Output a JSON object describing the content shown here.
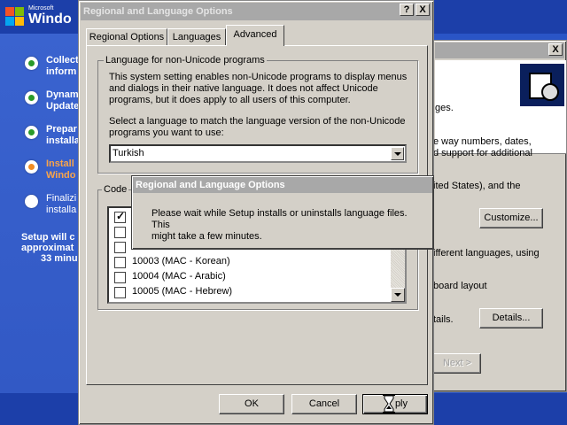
{
  "setup": {
    "logo_ms": "Microsoft",
    "logo_name": "Windo",
    "steps": [
      {
        "line1": "Collect",
        "line2": "inform",
        "state": "done"
      },
      {
        "line1": "Dynam",
        "line2": "Update",
        "state": "done"
      },
      {
        "line1": "Prepar",
        "line2": "installa",
        "state": "done"
      },
      {
        "line1": "Install",
        "line2": "Windo",
        "state": "current"
      },
      {
        "line1": "Finalizi",
        "line2": "installa",
        "state": "pending"
      }
    ],
    "remaining_line1": "Setup will c",
    "remaining_line2": "approximat",
    "remaining_line3": "33 minu",
    "colors": {
      "done_dot": "#2a9a2a",
      "current_dot": "#f08c24",
      "current_text": "#f9a44a"
    }
  },
  "back_window": {
    "close_glyph": "X",
    "header_text": "ges.",
    "line1": "e way numbers, dates,",
    "line2": "d support for additional",
    "line3": "ited States), and the",
    "customize_label": "Customize...",
    "line4": "ifferent languages, using",
    "line5": "board layout",
    "line6": "tails.",
    "details_label": "Details...",
    "next_label": "Next >"
  },
  "dialog": {
    "title": "Regional and Language Options",
    "help_glyph": "?",
    "close_glyph": "X",
    "tabs": [
      "Regional Options",
      "Languages",
      "Advanced"
    ],
    "active_tab": "Advanced",
    "nonunicode": {
      "legend": "Language for non-Unicode programs",
      "desc1": "This system setting enables non-Unicode programs to display menus",
      "desc2": "and dialogs in their native language. It does not affect Unicode",
      "desc3": "programs, but it does apply to all users of this computer.",
      "select1": "Select a language to match the language version of the non-Unicode",
      "select2": "programs you want to use:",
      "selected_language": "Turkish"
    },
    "codepage": {
      "legend": "Code",
      "items": [
        {
          "label": "",
          "checked": true
        },
        {
          "label": "",
          "checked": false
        },
        {
          "label": "",
          "checked": false
        },
        {
          "label": "10003 (MAC - Korean)",
          "checked": false
        },
        {
          "label": "10004 (MAC - Arabic)",
          "checked": false
        },
        {
          "label": "10005 (MAC - Hebrew)",
          "checked": false
        }
      ]
    },
    "ok_label": "OK",
    "cancel_label": "Cancel",
    "apply_label": "ply"
  },
  "popup": {
    "title": "Regional and Language Options",
    "message1": "Please wait while Setup installs or uninstalls language files. This",
    "message2": "might take a few minutes."
  }
}
